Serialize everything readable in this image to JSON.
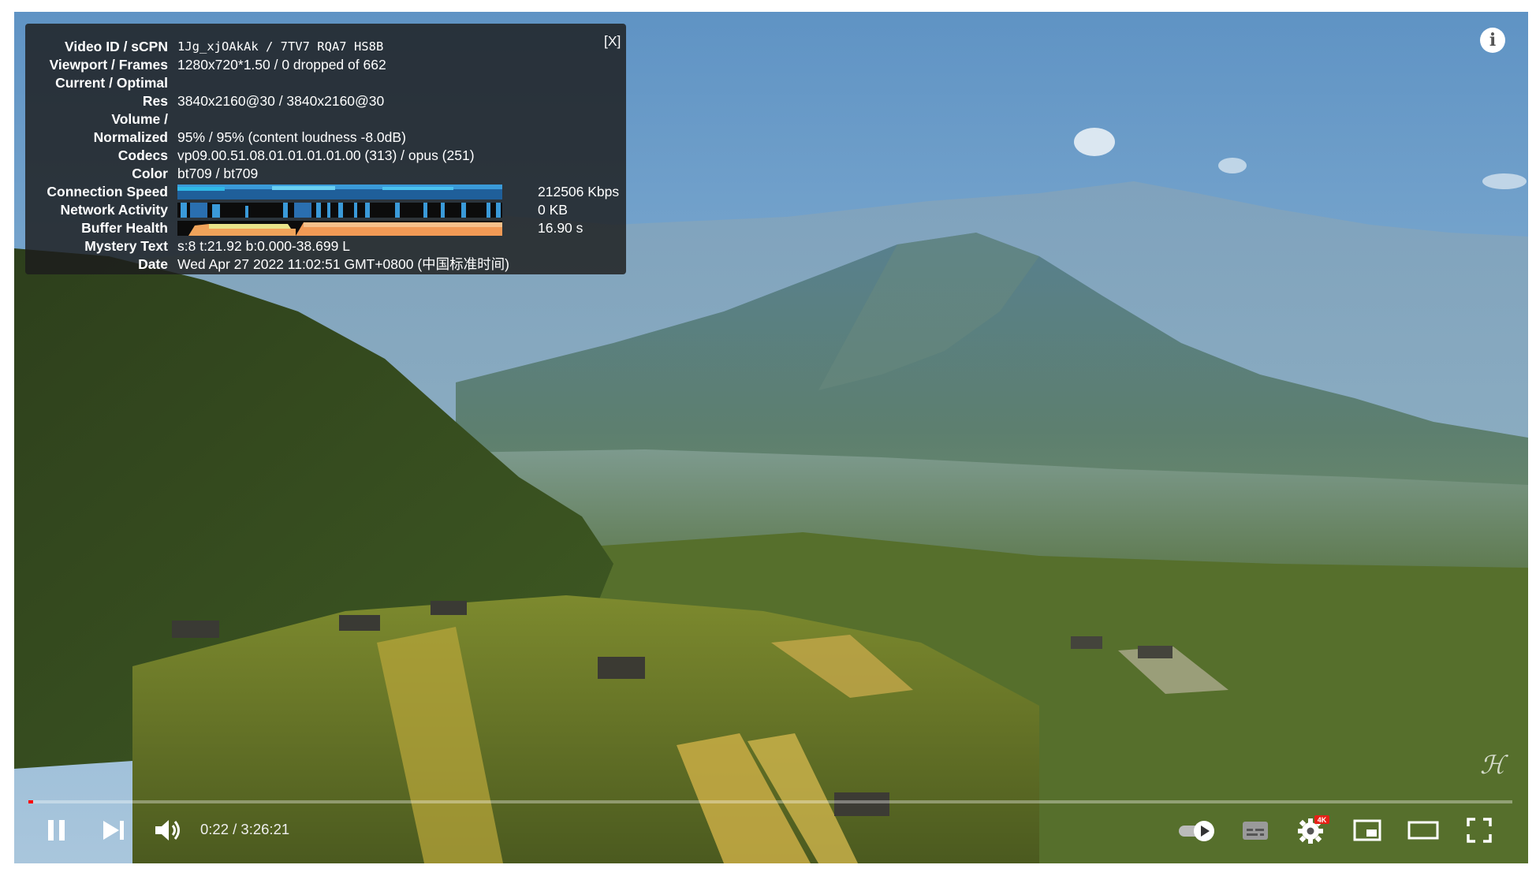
{
  "stats_panel": {
    "close_label": "[X]",
    "rows": [
      {
        "label": "Video ID / sCPN",
        "value": "1Jg_xjOAkAk / 7TV7 RQA7 HS8B"
      },
      {
        "label": "Viewport / Frames",
        "value": "1280x720*1.50 / 0 dropped of 662"
      },
      {
        "label": "Current / Optimal",
        "value": ""
      },
      {
        "label": "Res",
        "value": "3840x2160@30 / 3840x2160@30"
      },
      {
        "label": "Volume /",
        "value": ""
      },
      {
        "label": "Normalized",
        "value": "95% / 95% (content loudness -8.0dB)"
      },
      {
        "label": "Codecs",
        "value": "vp09.00.51.08.01.01.01.01.00 (313) / opus (251)"
      },
      {
        "label": "Color",
        "value": "bt709 / bt709"
      },
      {
        "label": "Connection Speed",
        "value": "212506 Kbps"
      },
      {
        "label": "Network Activity",
        "value": "0 KB"
      },
      {
        "label": "Buffer Health",
        "value": "16.90 s"
      },
      {
        "label": "Mystery Text",
        "value": "s:8 t:21.92 b:0.000-38.699 L"
      },
      {
        "label": "Date",
        "value": "Wed Apr 27 2022 11:02:51 GMT+0800 (中国标准时间)"
      }
    ]
  },
  "player": {
    "current_time": "0:22",
    "duration": "3:26:21",
    "time_display": "0:22 / 3:26:21",
    "progress_fraction": 0.0018,
    "quality_badge": "4K",
    "watermark": "ℋ",
    "accent_color": "#ff0000"
  },
  "icons": {
    "info": "info-icon",
    "pause": "pause-icon",
    "next": "next-icon",
    "volume": "volume-icon",
    "autoplay": "autoplay-toggle-icon",
    "subtitles": "subtitles-icon",
    "settings": "settings-icon",
    "miniplayer": "miniplayer-icon",
    "theater": "theater-mode-icon",
    "fullscreen": "fullscreen-icon"
  }
}
